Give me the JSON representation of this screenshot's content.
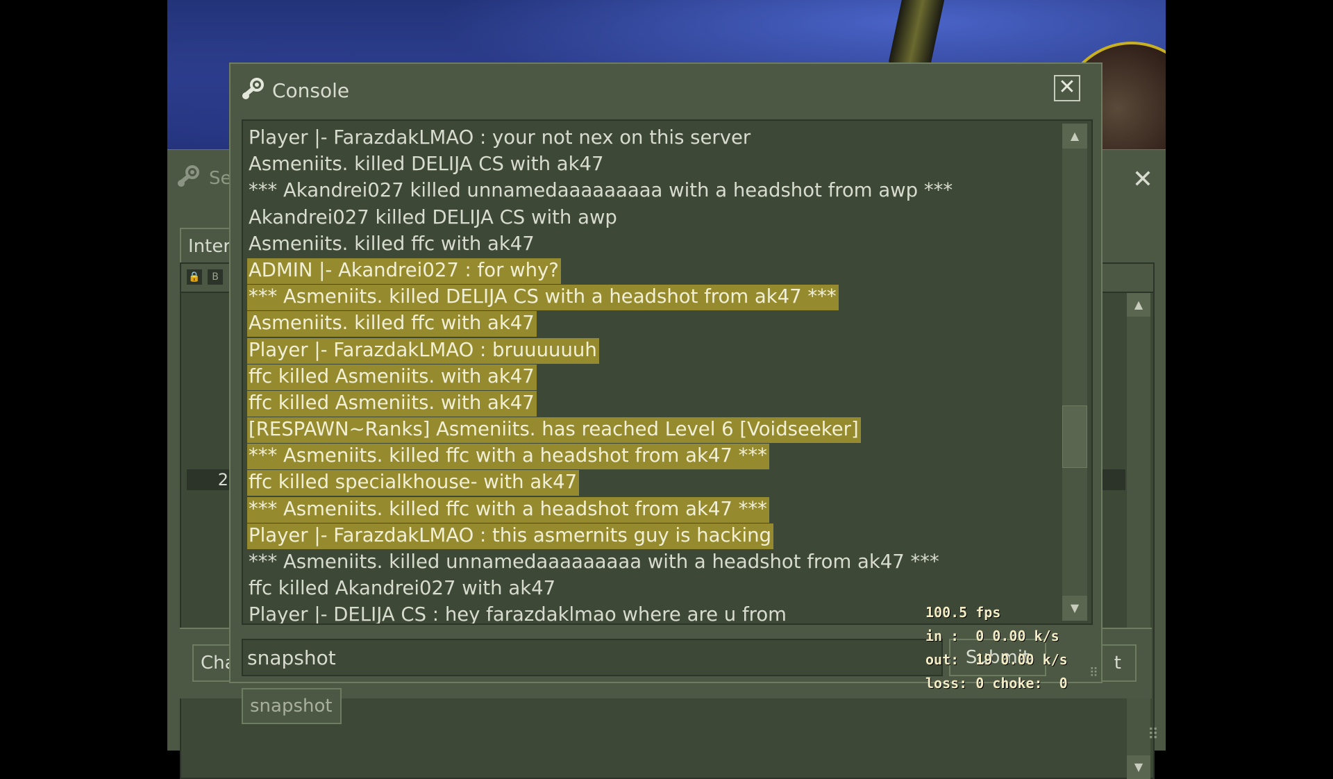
{
  "background_window": {
    "title": "Se",
    "tab_label": "Inter",
    "row_number": "2",
    "chat_button": "Cha",
    "right_button": "t"
  },
  "console": {
    "title": "Console",
    "lines": [
      {
        "text": "Player |- FarazdakLMAO : your not nex on this server",
        "highlighted": false
      },
      {
        "text": "Asmeniits. killed DELIJA CS with ak47",
        "highlighted": false
      },
      {
        "text": "*** Akandrei027 killed unnamedaaaaaaaaa with a headshot from awp ***",
        "highlighted": false
      },
      {
        "text": "Akandrei027 killed DELIJA CS with awp",
        "highlighted": false
      },
      {
        "text": "Asmeniits. killed ffc with ak47",
        "highlighted": false
      },
      {
        "text": "ADMIN |- Akandrei027 : for why?",
        "highlighted": true
      },
      {
        "text": "*** Asmeniits. killed DELIJA CS with a headshot from ak47 ***",
        "highlighted": true
      },
      {
        "text": "Asmeniits. killed ffc with ak47",
        "highlighted": true
      },
      {
        "text": "Player |- FarazdakLMAO : bruuuuuuh",
        "highlighted": true
      },
      {
        "text": "ffc killed Asmeniits. with ak47",
        "highlighted": true
      },
      {
        "text": "ffc killed Asmeniits. with ak47",
        "highlighted": true
      },
      {
        "text": "[RESPAWN~Ranks] Asmeniits. has reached Level 6 [Voidseeker]",
        "highlighted": true
      },
      {
        "text": "*** Asmeniits. killed ffc with a headshot from ak47 ***",
        "highlighted": true
      },
      {
        "text": "ffc killed specialkhouse- with ak47",
        "highlighted": true
      },
      {
        "text": "*** Asmeniits. killed ffc with a headshot from ak47 ***",
        "highlighted": true
      },
      {
        "text": "Player |- FarazdakLMAO : this asmernits guy is hacking",
        "highlighted": true
      },
      {
        "text": "*** Asmeniits. killed unnamedaaaaaaaaa with a headshot from ak47 ***",
        "highlighted": false
      },
      {
        "text": "ffc killed Akandrei027 with ak47",
        "highlighted": false
      },
      {
        "text": "Player |- DELIJA CS : hey farazdaklmao where are u from",
        "highlighted": false
      }
    ],
    "input_value": "snapshot",
    "submit_label": "Submit",
    "autocomplete_suggestion": "snapshot"
  },
  "net_graph": {
    "fps": "100.5 fps",
    "in": "in :  0 0.00 k/s",
    "out": "out:  19 0.00 k/s",
    "loss": "loss: 0 choke:  0"
  },
  "colors": {
    "panel": "#4c5844",
    "highlight": "#958a2e",
    "text": "#d8dcd0"
  }
}
